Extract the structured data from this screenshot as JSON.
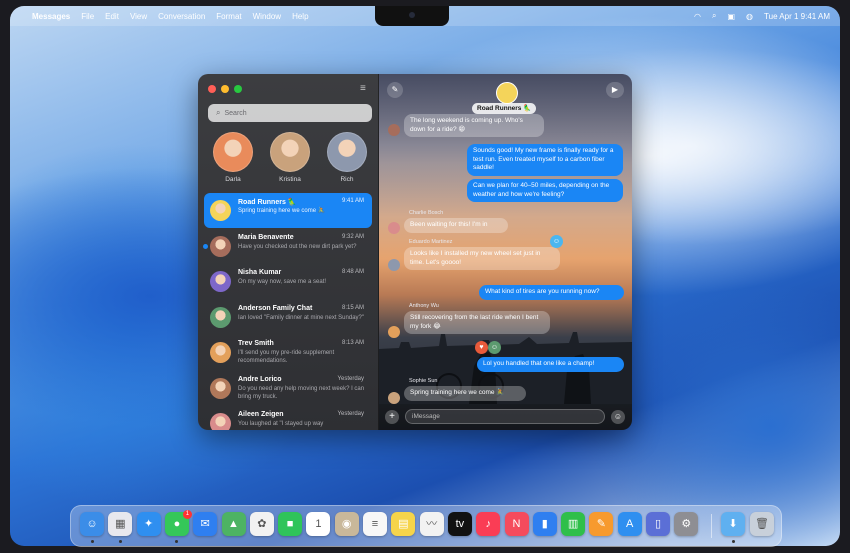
{
  "menubar": {
    "app": "Messages",
    "items": [
      "File",
      "Edit",
      "View",
      "Conversation",
      "Format",
      "Window",
      "Help"
    ],
    "clock": "Tue Apr 1  9:41 AM"
  },
  "sidebar": {
    "search_placeholder": "Search",
    "pinned": [
      {
        "name": "Darla",
        "color": "#e98b5b"
      },
      {
        "name": "Kristina",
        "color": "#c9a27c"
      },
      {
        "name": "Rich",
        "color": "#8d98ad"
      }
    ],
    "conversations": [
      {
        "name": "Road Runners 🦜",
        "time": "9:41 AM",
        "preview": "Spring training here we come 🚴",
        "color": "#f4d45a",
        "active": true,
        "unread": false
      },
      {
        "name": "Maria Benavente",
        "time": "9:32 AM",
        "preview": "Have you checked out the new dirt park yet?",
        "color": "#a66d5c",
        "active": false,
        "unread": true
      },
      {
        "name": "Nisha Kumar",
        "time": "8:48 AM",
        "preview": "On my way now, save me a seat!",
        "color": "#7d67c9",
        "active": false,
        "unread": false
      },
      {
        "name": "Anderson Family Chat",
        "time": "8:15 AM",
        "preview": "Ian loved \"Family dinner at mine next Sunday?\"",
        "color": "#5c9a6f",
        "active": false,
        "unread": false
      },
      {
        "name": "Trev Smith",
        "time": "8:13 AM",
        "preview": "I'll send you my pre-ride supplement recommendations.",
        "color": "#e3a05b",
        "active": false,
        "unread": false
      },
      {
        "name": "Andre Lorico",
        "time": "Yesterday",
        "preview": "Do you need any help moving next week? I can bring my truck.",
        "color": "#b0785a",
        "active": false,
        "unread": false
      },
      {
        "name": "Aileen Zeigen",
        "time": "Yesterday",
        "preview": "You laughed at \"I stayed up way",
        "color": "#d98c8c",
        "active": false,
        "unread": false
      }
    ]
  },
  "chat": {
    "title": "Road Runners 🦜",
    "messages": [
      {
        "dir": "in",
        "text": "The long weekend is coming up. Who's down for a ride? 😁"
      },
      {
        "dir": "out",
        "text": "Sounds good! My new frame is finally ready for a test run. Even treated myself to a carbon fiber saddle!"
      },
      {
        "dir": "out",
        "text": "Can we plan for 40–50 miles, depending on the weather and how we're feeling?"
      },
      {
        "dir": "in",
        "sender": "Charlie Bosch",
        "text": "Been waiting for this! I'm in"
      },
      {
        "dir": "in",
        "sender": "Eduardo Martinez",
        "text": "Looks like I installed my new wheel set just in time. Let's goooo!"
      },
      {
        "dir": "out",
        "text": "What kind of tires are you running now?"
      },
      {
        "dir": "in",
        "sender": "Anthony Wu",
        "text": "Still recovering from the last ride when I bent my fork 😂"
      },
      {
        "dir": "out",
        "text": "Lol you handled that one like a champ!"
      },
      {
        "dir": "in",
        "sender": "Sophie Sun",
        "text": "Spring training here we come 🚴"
      }
    ],
    "input_placeholder": "iMessage"
  },
  "dock": {
    "apps": [
      {
        "name": "finder-icon",
        "glyph": "☺",
        "color": "#3b8de8"
      },
      {
        "name": "launchpad-icon",
        "glyph": "▦",
        "color": "#e8e8ee"
      },
      {
        "name": "safari-icon",
        "glyph": "✦",
        "color": "#2f8ff0"
      },
      {
        "name": "messages-icon",
        "glyph": "●",
        "color": "#35c759",
        "badge": "1"
      },
      {
        "name": "mail-icon",
        "glyph": "✉",
        "color": "#2f7ff0"
      },
      {
        "name": "maps-icon",
        "glyph": "▲",
        "color": "#4db363"
      },
      {
        "name": "photos-icon",
        "glyph": "✿",
        "color": "#f2f2f2"
      },
      {
        "name": "facetime-icon",
        "glyph": "■",
        "color": "#2fc45a"
      },
      {
        "name": "calendar-icon",
        "glyph": "1",
        "color": "#ffffff"
      },
      {
        "name": "contacts-icon",
        "glyph": "◉",
        "color": "#c9b89a"
      },
      {
        "name": "reminders-icon",
        "glyph": "≡",
        "color": "#f7f7f7"
      },
      {
        "name": "notes-icon",
        "glyph": "▤",
        "color": "#f6d44a"
      },
      {
        "name": "freeform-icon",
        "glyph": "〰",
        "color": "#f2f2f2"
      },
      {
        "name": "apple-tv-icon",
        "glyph": "tv",
        "color": "#111111"
      },
      {
        "name": "music-icon",
        "glyph": "♪",
        "color": "#fa3d55"
      },
      {
        "name": "news-icon",
        "glyph": "N",
        "color": "#f54b5d"
      },
      {
        "name": "keynote-icon",
        "glyph": "▮",
        "color": "#2f7ff0"
      },
      {
        "name": "numbers-icon",
        "glyph": "▥",
        "color": "#2fbf4a"
      },
      {
        "name": "pages-icon",
        "glyph": "✎",
        "color": "#f79a2e"
      },
      {
        "name": "app-store-icon",
        "glyph": "A",
        "color": "#2f8ff0"
      },
      {
        "name": "iphone-mirroring-icon",
        "glyph": "▯",
        "color": "#5b6fd6"
      },
      {
        "name": "system-settings-icon",
        "glyph": "⚙",
        "color": "#8e8e93"
      },
      {
        "name": "downloads-folder-icon",
        "glyph": "⬇",
        "color": "#5fb0f0"
      },
      {
        "name": "trash-icon",
        "glyph": "🗑",
        "color": "#c8d0da"
      }
    ]
  }
}
